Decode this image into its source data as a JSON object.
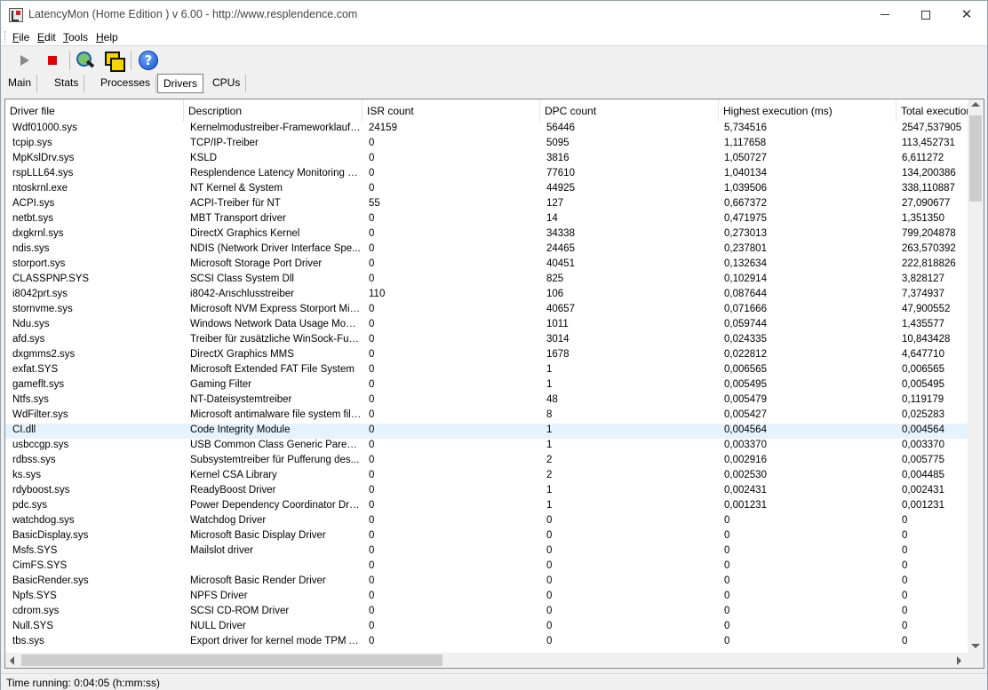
{
  "window": {
    "title": "LatencyMon  (Home Edition )  v 6.00 - http://www.resplendence.com",
    "minimize_icon": "minimize-icon",
    "maximize_icon": "maximize-icon",
    "close_icon": "close-icon"
  },
  "menu": {
    "items": [
      {
        "mnemonic": "F",
        "rest": "ile"
      },
      {
        "mnemonic": "E",
        "rest": "dit"
      },
      {
        "mnemonic": "T",
        "rest": "ools"
      },
      {
        "mnemonic": "H",
        "rest": "elp"
      }
    ]
  },
  "toolbar": {
    "buttons": [
      "play-icon",
      "stop-icon",
      "system-scan-icon",
      "windows-icon",
      "help-icon"
    ],
    "help_glyph": "?"
  },
  "tabs": {
    "items": [
      "Main",
      "Stats",
      "Processes",
      "Drivers",
      "CPUs"
    ],
    "active": "Drivers"
  },
  "table": {
    "headers": [
      "Driver file",
      "Description",
      "ISR count",
      "DPC count",
      "Highest execution (ms)",
      "Total execution"
    ],
    "selected_row": 20,
    "rows": [
      [
        "Wdf01000.sys",
        "Kernelmodustreiber-Frameworklaufzeit",
        "24159",
        "56446",
        "5,734516",
        "2547,537905"
      ],
      [
        "tcpip.sys",
        "TCP/IP-Treiber",
        "0",
        "5095",
        "1,117658",
        "113,452731"
      ],
      [
        "MpKslDrv.sys",
        "KSLD",
        "0",
        "3816",
        "1,050727",
        "6,611272"
      ],
      [
        "rspLLL64.sys",
        "Resplendence Latency Monitoring a...",
        "0",
        "77610",
        "1,040134",
        "134,200386"
      ],
      [
        "ntoskrnl.exe",
        "NT Kernel & System",
        "0",
        "44925",
        "1,039506",
        "338,110887"
      ],
      [
        "ACPI.sys",
        "ACPI-Treiber für NT",
        "55",
        "127",
        "0,667372",
        "27,090677"
      ],
      [
        "netbt.sys",
        "MBT Transport driver",
        "0",
        "14",
        "0,471975",
        "1,351350"
      ],
      [
        "dxgkrnl.sys",
        "DirectX Graphics Kernel",
        "0",
        "34338",
        "0,273013",
        "799,204878"
      ],
      [
        "ndis.sys",
        "NDIS (Network Driver Interface Spe...",
        "0",
        "24465",
        "0,237801",
        "263,570392"
      ],
      [
        "storport.sys",
        "Microsoft Storage Port Driver",
        "0",
        "40451",
        "0,132634",
        "222,818826"
      ],
      [
        "CLASSPNP.SYS",
        "SCSI Class System Dll",
        "0",
        "825",
        "0,102914",
        "3,828127"
      ],
      [
        "i8042prt.sys",
        "i8042-Anschlusstreiber",
        "110",
        "106",
        "0,087644",
        "7,374937"
      ],
      [
        "stornvme.sys",
        "Microsoft NVM Express Storport Mini...",
        "0",
        "40657",
        "0,071666",
        "47,900552"
      ],
      [
        "Ndu.sys",
        "Windows Network Data Usage Monit...",
        "0",
        "1011",
        "0,059744",
        "1,435577"
      ],
      [
        "afd.sys",
        "Treiber für zusätzliche WinSock-Fun...",
        "0",
        "3014",
        "0,024335",
        "10,843428"
      ],
      [
        "dxgmms2.sys",
        "DirectX Graphics MMS",
        "0",
        "1678",
        "0,022812",
        "4,647710"
      ],
      [
        "exfat.SYS",
        "Microsoft Extended FAT File System",
        "0",
        "1",
        "0,006565",
        "0,006565"
      ],
      [
        "gameflt.sys",
        "Gaming Filter",
        "0",
        "1",
        "0,005495",
        "0,005495"
      ],
      [
        "Ntfs.sys",
        "NT-Dateisystemtreiber",
        "0",
        "48",
        "0,005479",
        "0,119179"
      ],
      [
        "WdFilter.sys",
        "Microsoft antimalware file system filt...",
        "0",
        "8",
        "0,005427",
        "0,025283"
      ],
      [
        "CI.dll",
        "Code Integrity Module",
        "0",
        "1",
        "0,004564",
        "0,004564"
      ],
      [
        "usbccgp.sys",
        "USB Common Class Generic Parent ...",
        "0",
        "1",
        "0,003370",
        "0,003370"
      ],
      [
        "rdbss.sys",
        "Subsystemtreiber für Pufferung des...",
        "0",
        "2",
        "0,002916",
        "0,005775"
      ],
      [
        "ks.sys",
        "Kernel CSA Library",
        "0",
        "2",
        "0,002530",
        "0,004485"
      ],
      [
        "rdyboost.sys",
        "ReadyBoost Driver",
        "0",
        "1",
        "0,002431",
        "0,002431"
      ],
      [
        "pdc.sys",
        "Power Dependency Coordinator Driver",
        "0",
        "1",
        "0,001231",
        "0,001231"
      ],
      [
        "watchdog.sys",
        "Watchdog Driver",
        "0",
        "0",
        "0",
        "0"
      ],
      [
        "BasicDisplay.sys",
        "Microsoft Basic Display Driver",
        "0",
        "0",
        "0",
        "0"
      ],
      [
        "Msfs.SYS",
        "Mailslot driver",
        "0",
        "0",
        "0",
        "0"
      ],
      [
        "CimFS.SYS",
        "",
        "0",
        "0",
        "0",
        "0"
      ],
      [
        "BasicRender.sys",
        "Microsoft Basic Render Driver",
        "0",
        "0",
        "0",
        "0"
      ],
      [
        "Npfs.SYS",
        "NPFS Driver",
        "0",
        "0",
        "0",
        "0"
      ],
      [
        "cdrom.sys",
        "SCSI CD-ROM Driver",
        "0",
        "0",
        "0",
        "0"
      ],
      [
        "Null.SYS",
        "NULL Driver",
        "0",
        "0",
        "0",
        "0"
      ],
      [
        "tbs.sys",
        "Export driver for kernel mode TPM API",
        "0",
        "0",
        "0",
        "0"
      ]
    ]
  },
  "status": {
    "text": "Time running: 0:04:05  (h:mm:ss)"
  },
  "colors": {
    "selected_row": "#e5f3ff",
    "stop": "#e00000",
    "help": "#1552c9"
  }
}
